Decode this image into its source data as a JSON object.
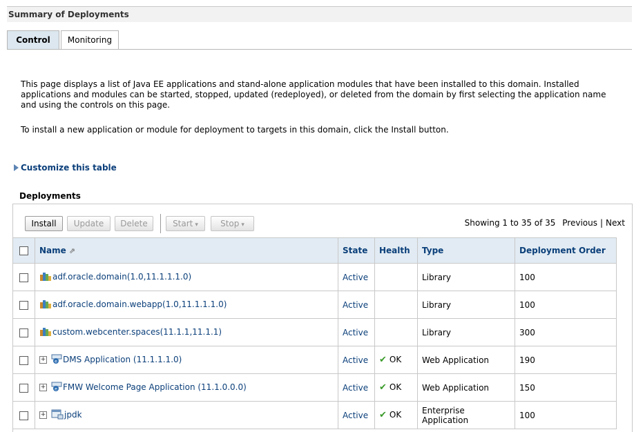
{
  "page": {
    "title": "Summary of Deployments",
    "tabs": [
      {
        "label": "Control",
        "active": true
      },
      {
        "label": "Monitoring",
        "active": false
      }
    ],
    "description_1": "This page displays a list of Java EE applications and stand-alone application modules that have been installed to this domain. Installed applications and modules can be started, stopped, updated (redeployed), or deleted from the domain by first selecting the application name and using the controls on this page.",
    "description_2": "To install a new application or module for deployment to targets in this domain, click the Install button.",
    "customize_link": "Customize this table"
  },
  "deployments": {
    "section_title": "Deployments",
    "toolbar": {
      "install": "Install",
      "update": "Update",
      "delete": "Delete",
      "start": "Start",
      "stop": "Stop"
    },
    "paging": {
      "showing": "Showing 1 to 35 of 35",
      "previous": "Previous",
      "next": "Next"
    },
    "columns": {
      "name": "Name",
      "state": "State",
      "health": "Health",
      "type": "Type",
      "order": "Deployment Order"
    },
    "rows": [
      {
        "name": "adf.oracle.domain(1.0,11.1.1.1.0)",
        "icon": "library-icon",
        "expand": "",
        "state": "Active",
        "health": "",
        "type": "Library",
        "order": "100"
      },
      {
        "name": "adf.oracle.domain.webapp(1.0,11.1.1.1.0)",
        "icon": "library-icon",
        "expand": "",
        "state": "Active",
        "health": "",
        "type": "Library",
        "order": "100"
      },
      {
        "name": "custom.webcenter.spaces(11.1.1,11.1.1)",
        "icon": "library-icon",
        "expand": "",
        "state": "Active",
        "health": "",
        "type": "Library",
        "order": "300"
      },
      {
        "name": "DMS Application (11.1.1.1.0)",
        "icon": "web-application-icon",
        "expand": "+",
        "state": "Active",
        "health": "OK",
        "type": "Web Application",
        "order": "190"
      },
      {
        "name": "FMW Welcome Page Application (11.1.0.0.0)",
        "icon": "web-application-icon",
        "expand": "+",
        "state": "Active",
        "health": "OK",
        "type": "Web Application",
        "order": "150"
      },
      {
        "name": "jpdk",
        "icon": "enterprise-application-icon",
        "expand": "+",
        "state": "Active",
        "health": "OK",
        "type": "Enterprise Application",
        "order": "100"
      }
    ]
  }
}
